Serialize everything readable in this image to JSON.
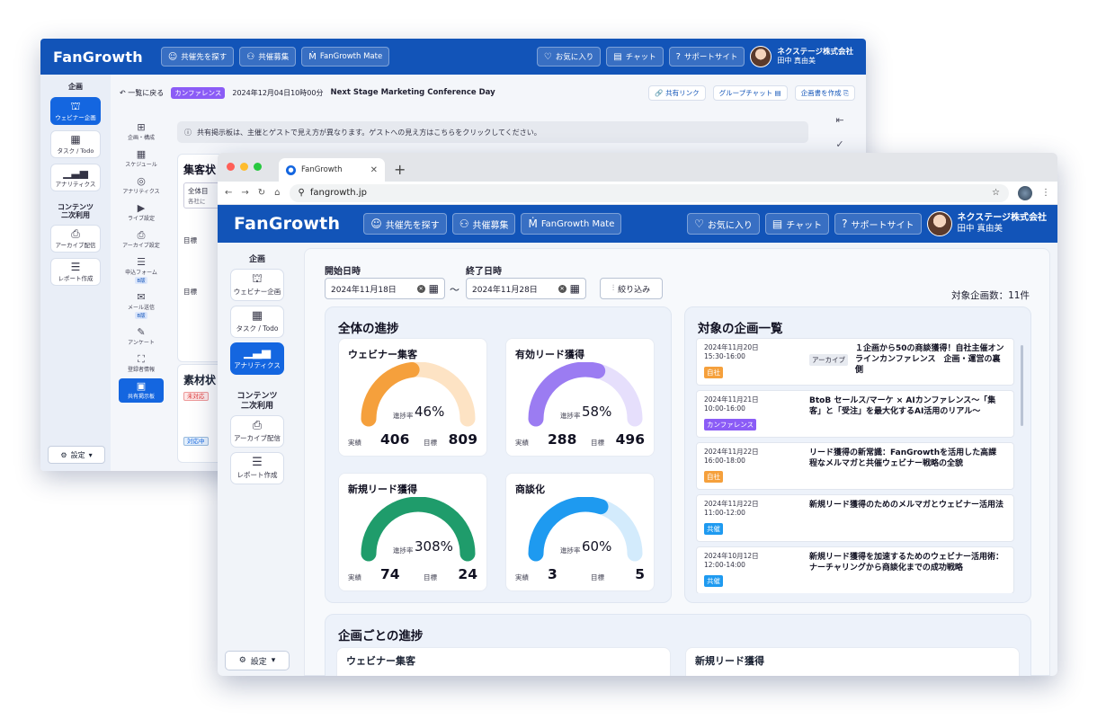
{
  "back_window": {
    "logo": "FanGrowth",
    "nav": {
      "find": "共催先を探す",
      "recruit": "共催募集",
      "mate": "FanGrowth Mate",
      "favorites": "お気に入り",
      "chat": "チャット",
      "support": "サポートサイト"
    },
    "user": {
      "company": "ネクステージ株式会社",
      "name": "田中 真由美"
    },
    "sidebar": {
      "section1": "企画",
      "items": [
        "ウェビナー企画",
        "タスク / Todo",
        "アナリティクス"
      ],
      "section2_line1": "コンテンツ",
      "section2_line2": "二次利用",
      "items2": [
        "アーカイブ配信",
        "レポート作成"
      ]
    },
    "settings": "設定",
    "breadcrumb": {
      "back": "一覧に戻る",
      "tag": "カンファレンス",
      "datetime": "2024年12月04日10時00分",
      "title": "Next Stage Marketing Conference Day",
      "share": "共有リンク",
      "group_chat": "グループチャット",
      "create_plan": "企画書を作成"
    },
    "subnav": [
      {
        "label": "企画・構成",
        "badge": ""
      },
      {
        "label": "スケジュール",
        "badge": ""
      },
      {
        "label": "アナリティクス",
        "badge": ""
      },
      {
        "label": "ライブ設定",
        "badge": ""
      },
      {
        "label": "アーカイブ設定",
        "badge": ""
      },
      {
        "label": "申込フォーム",
        "badge": "B版"
      },
      {
        "label": "メール送信",
        "badge": "B版"
      },
      {
        "label": "アンケート",
        "badge": ""
      },
      {
        "label": "登録者情報",
        "badge": ""
      },
      {
        "label": "共有掲示板",
        "badge": ""
      }
    ],
    "notice": "共有掲示板は、主催とゲストで見え方が異なります。ゲストへの見え方はこちらをクリックしてください。",
    "panel1": {
      "title": "集客状",
      "select": "全体目",
      "sub": "各社に",
      "goal1": "目標",
      "goal2": "目標"
    },
    "panel2": {
      "title": "素材状",
      "badge1": "未対応",
      "badge2": "対応中"
    }
  },
  "browser": {
    "tab_title": "FanGrowth",
    "url": "fangrowth.jp"
  },
  "app": {
    "logo": "FanGrowth",
    "nav": {
      "find": "共催先を探す",
      "recruit": "共催募集",
      "mate": "FanGrowth Mate",
      "favorites": "お気に入り",
      "chat": "チャット",
      "support": "サポートサイト"
    },
    "user": {
      "company": "ネクステージ株式会社",
      "name": "田中 真由美"
    },
    "sidebar": {
      "section1": "企画",
      "items": [
        {
          "label": "ウェビナー企画",
          "icon": "webinar-icon"
        },
        {
          "label": "タスク / Todo",
          "icon": "calendar-icon"
        },
        {
          "label": "アナリティクス",
          "icon": "chart-icon"
        }
      ],
      "section2_line1": "コンテンツ",
      "section2_line2": "二次利用",
      "items2": [
        {
          "label": "アーカイブ配信",
          "icon": "archive-icon"
        },
        {
          "label": "レポート作成",
          "icon": "report-icon"
        }
      ]
    },
    "settings": "設定",
    "filter": {
      "start_label": "開始日時",
      "start_value": "2024年11月18日",
      "end_label": "終了日時",
      "end_value": "2024年11月28日",
      "tilde": "〜",
      "button": "絞り込み"
    },
    "count": "対象企画数：11件",
    "overall": {
      "title": "全体の進捗",
      "rate_label": "進捗率",
      "actual_label": "実績",
      "target_label": "目標",
      "gauges": [
        {
          "title": "ウェビナー集客",
          "rate": "46%",
          "fraction": 0.46,
          "actual": "406",
          "target": "809",
          "color": "#f5a03c",
          "track": "#fde3c4"
        },
        {
          "title": "有効リード獲得",
          "rate": "58%",
          "fraction": 0.58,
          "actual": "288",
          "target": "496",
          "color": "#9b7cf2",
          "track": "#e6dffc"
        },
        {
          "title": "新規リード獲得",
          "rate": "308%",
          "fraction": 1.0,
          "actual": "74",
          "target": "24",
          "color": "#1f9c6b",
          "track": "#c9ecdd"
        },
        {
          "title": "商談化",
          "rate": "60%",
          "fraction": 0.6,
          "actual": "3",
          "target": "5",
          "color": "#1e9af0",
          "track": "#d3ebfc"
        }
      ]
    },
    "plans": {
      "title": "対象の企画一覧",
      "items": [
        {
          "date": "2024年11月20日",
          "time": "15:30-16:00",
          "badge": "自社",
          "badge_color": "#f5a03c",
          "category": "アーカイブ",
          "title": "１企画から50の商談獲得！自社主催オンラインカンファレンス　企画・運営の裏側"
        },
        {
          "date": "2024年11月21日",
          "time": "10:00-16:00",
          "badge": "カンファレンス",
          "badge_color": "#8b5cf6",
          "category": "",
          "title": "BtoB セールス/マーケ × AIカンファレンス〜「集客」と「受注」を最大化するAI活用のリアル〜"
        },
        {
          "date": "2024年11月22日",
          "time": "16:00-18:00",
          "badge": "自社",
          "badge_color": "#f5a03c",
          "category": "",
          "title": "リード獲得の新常識：FanGrowthを活用した高課程なメルマガと共催ウェビナー戦略の全貌"
        },
        {
          "date": "2024年11月22日",
          "time": "11:00-12:00",
          "badge": "共催",
          "badge_color": "#1e9af0",
          "category": "",
          "title": "新規リード獲得のためのメルマガとウェビナー活用法"
        },
        {
          "date": "2024年10月12日",
          "time": "12:00-14:00",
          "badge": "共催",
          "badge_color": "#1e9af0",
          "category": "",
          "title": "新規リード獲得を加速するためのウェビナー活用術：ナーチャリングから商談化までの成功戦略"
        }
      ]
    },
    "per_plan": {
      "title": "企画ごとの進捗",
      "cards": [
        "ウェビナー集客",
        "新規リード獲得"
      ]
    }
  }
}
